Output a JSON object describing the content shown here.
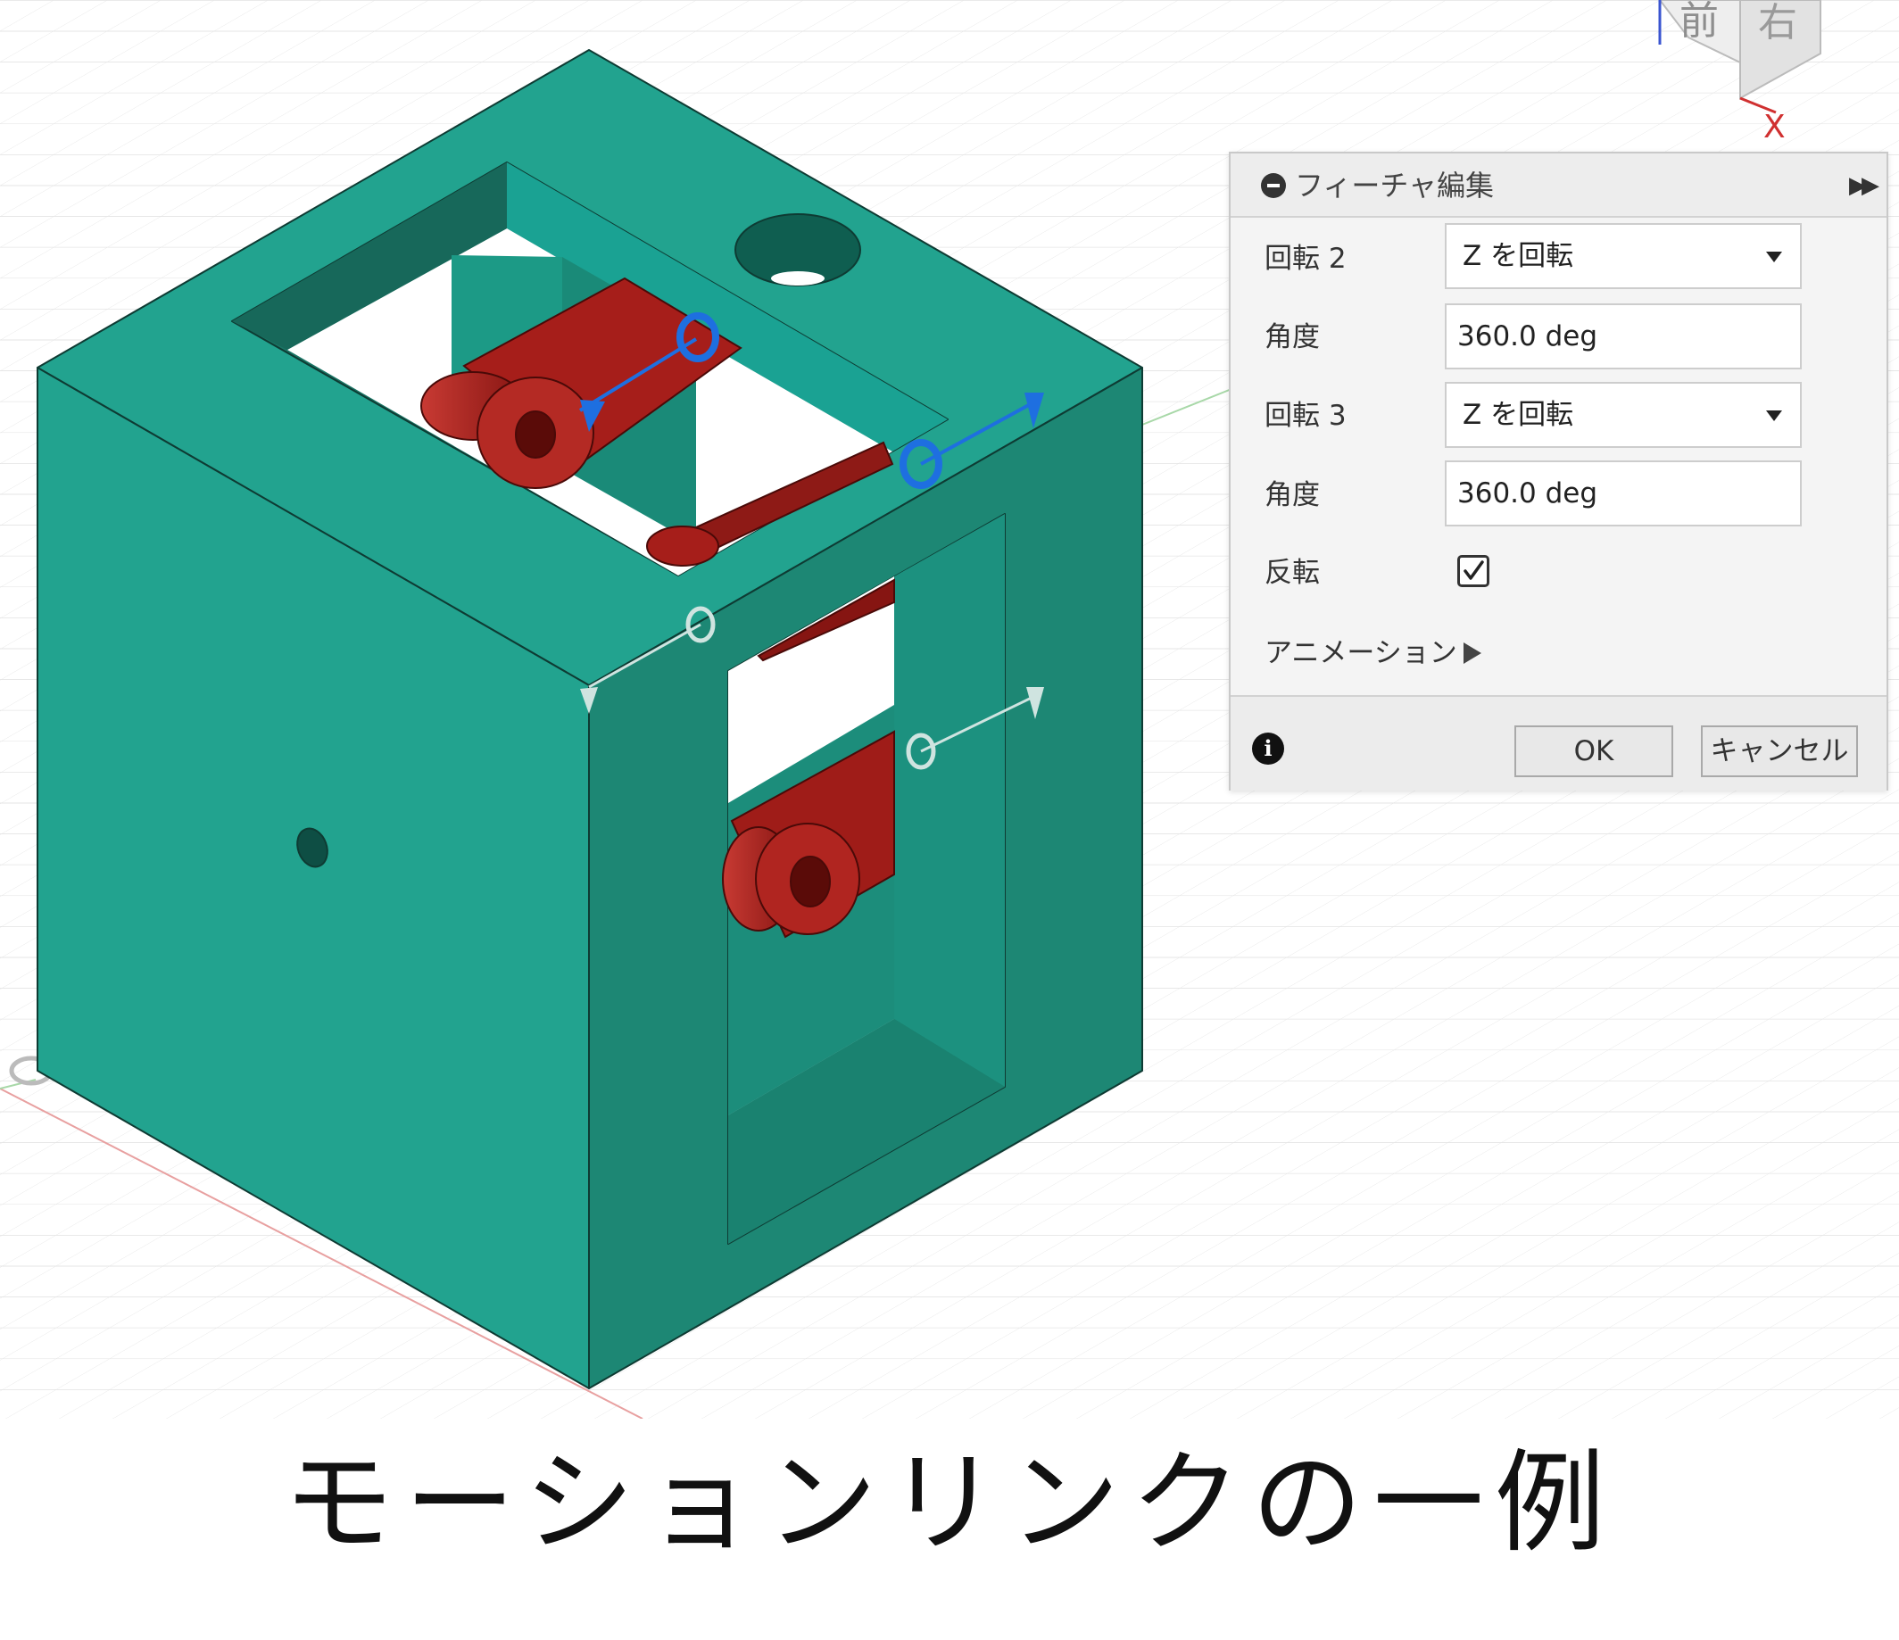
{
  "viewport": {
    "view_cube": {
      "face_front": "前",
      "face_right": "右",
      "axis_x": "X"
    }
  },
  "dialog": {
    "title": "フィーチャ編集",
    "rows": [
      {
        "label": "回転 2",
        "kind": "select",
        "value": "Z を回転"
      },
      {
        "label": "角度",
        "kind": "input",
        "value": "360.0 deg"
      },
      {
        "label": "回転 3",
        "kind": "select",
        "value": "Z を回転"
      },
      {
        "label": "角度",
        "kind": "input",
        "value": "360.0 deg"
      },
      {
        "label": "反転",
        "kind": "checkbox",
        "checked": true
      },
      {
        "label": "アニメーション",
        "kind": "play"
      }
    ],
    "ok_label": "OK",
    "cancel_label": "キャンセル",
    "icons": {
      "collapse": "collapse-circle-minus-icon",
      "expand": "double-chevron-right-icon",
      "info": "info-icon",
      "check": "checkmark-icon",
      "play": "play-triangle-icon"
    }
  },
  "caption": "モーションリンクの一例",
  "colors": {
    "body_light": "#22a38f",
    "body_dark": "#1b8672",
    "link_red": "#a61e1a",
    "joint_blue": "#1e6fe0"
  }
}
